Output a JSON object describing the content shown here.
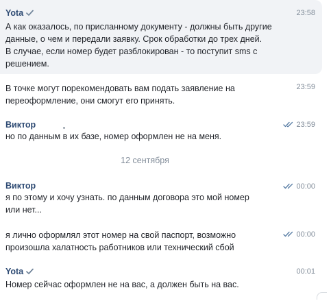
{
  "messages": [
    {
      "sender": "Yota",
      "verified": true,
      "time": "23:58",
      "text": "А как оказалось, по присланному документу - должны быть другие\nданные, о чем и передали заявку. Срок обработки до трех дней.\nВ случае, если номер будет разблокирован - то поступит sms с\nрешением."
    },
    {
      "time": "23:59",
      "text": "В точке могут порекомендовать вам подать заявление на\nпереоформление, они смогут его принять."
    },
    {
      "sender": "Виктор",
      "time": "23:59",
      "read": true,
      "text": "но по данным в их базе, номер оформлен не на меня."
    },
    {
      "sender": "Виктор",
      "time": "00:00",
      "read": true,
      "text": "я по этому и хочу узнать. по данным договора это мой номер\nили нет..."
    },
    {
      "time": "00:00",
      "read": true,
      "text": "я лично оформлял этот номер на свой паспорт, возможно\nпроизошла халатность работников или технический сбой"
    },
    {
      "sender": "Yota",
      "verified": true,
      "time": "00:01",
      "text": "Номер сейчас оформлен не на вас, а должен быть на вас."
    }
  ],
  "date_separator": "12 сентября",
  "colors": {
    "sender": "#2d4a73",
    "time": "#818c99",
    "text": "#1f2228",
    "verified": "#6f8399",
    "read_check": "#5b7fa6",
    "selected_bg": "#f1f3f6"
  }
}
